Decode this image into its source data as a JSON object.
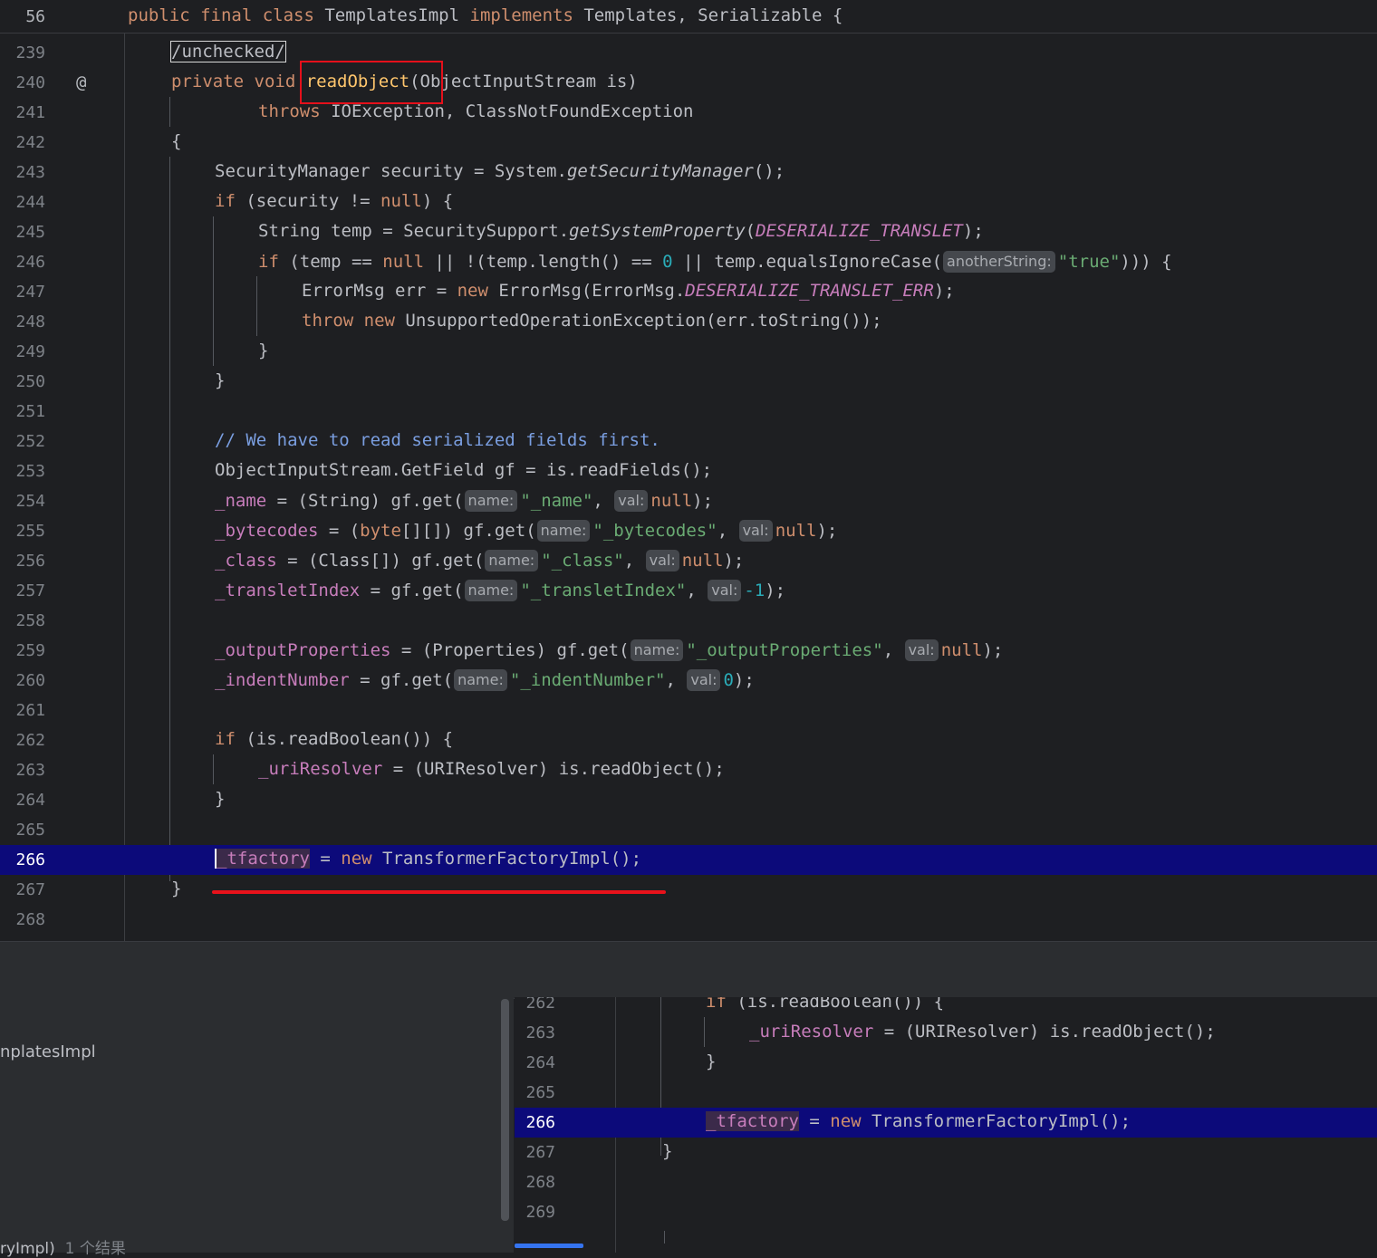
{
  "sticky": {
    "line_no": "56",
    "kw1": "public final class",
    "name": " TemplatesImpl ",
    "kw2": "implements",
    "rest": " Templates, Serializable {"
  },
  "hints": {
    "anotherString": "anotherString:",
    "name": "name:",
    "val": "val:"
  },
  "lines": [
    {
      "n": "239"
    },
    {
      "n": "240"
    },
    {
      "n": "241"
    },
    {
      "n": "242"
    },
    {
      "n": "243"
    },
    {
      "n": "244"
    },
    {
      "n": "245"
    },
    {
      "n": "246"
    },
    {
      "n": "247"
    },
    {
      "n": "248"
    },
    {
      "n": "249"
    },
    {
      "n": "250"
    },
    {
      "n": "251"
    },
    {
      "n": "252"
    },
    {
      "n": "253"
    },
    {
      "n": "254"
    },
    {
      "n": "255"
    },
    {
      "n": "256"
    },
    {
      "n": "257"
    },
    {
      "n": "258"
    },
    {
      "n": "259"
    },
    {
      "n": "260"
    },
    {
      "n": "261"
    },
    {
      "n": "262"
    },
    {
      "n": "263"
    },
    {
      "n": "264"
    },
    {
      "n": "265"
    },
    {
      "n": "266"
    },
    {
      "n": "267"
    },
    {
      "n": "268"
    }
  ],
  "code": {
    "l239": "/unchecked/",
    "l240a": "private void ",
    "l240b": "readObject",
    "l240c": "(ObjectInputStream is)",
    "l241a": "throws",
    "l241b": " IOException, ClassNotFoundException",
    "l242": "{",
    "l243a": "SecurityManager security = System.",
    "l243b": "getSecurityManager",
    "l243c": "();",
    "l244a": "if",
    "l244b": " (security != ",
    "l244c": "null",
    "l244d": ") {",
    "l245a": "String temp = SecuritySupport.",
    "l245b": "getSystemProperty",
    "l245c": "(",
    "l245d": "DESERIALIZE_TRANSLET",
    "l245e": ");",
    "l246a": "if",
    "l246b": " (temp == ",
    "l246c": "null",
    "l246d": " || !(temp.length() == ",
    "l246e": "0",
    "l246f": " || temp.equalsIgnoreCase(",
    "l246g": "\"true\"",
    "l246h": "))) {",
    "l247a": "ErrorMsg err = ",
    "l247b": "new",
    "l247c": " ErrorMsg(ErrorMsg.",
    "l247d": "DESERIALIZE_TRANSLET_ERR",
    "l247e": ");",
    "l248a": "throw new",
    "l248b": " UnsupportedOperationException(err.toString());",
    "l249": "}",
    "l250": "}",
    "l252": "// We have to read serialized fields first.",
    "l253": "ObjectInputStream.GetField gf = is.readFields();",
    "l254a": "_name",
    "l254b": " = (String) gf.get(",
    "l254c": "\"_name\"",
    "l254d": ", ",
    "l254e": "null",
    "l254f": ");",
    "l255a": "_bytecodes",
    "l255b": " = (",
    "l255c": "byte",
    "l255d": "[][]) gf.get(",
    "l255e": "\"_bytecodes\"",
    "l255f": ", ",
    "l255g": "null",
    "l255h": ");",
    "l256a": "_class",
    "l256b": " = (Class[]) gf.get(",
    "l256c": "\"_class\"",
    "l256d": ", ",
    "l256e": "null",
    "l256f": ");",
    "l257a": "_transletIndex",
    "l257b": " = gf.get(",
    "l257c": "\"_transletIndex\"",
    "l257d": ", ",
    "l257e": "-1",
    "l257f": ");",
    "l259a": "_outputProperties",
    "l259b": " = (Properties) gf.get(",
    "l259c": "\"_outputProperties\"",
    "l259d": ", ",
    "l259e": "null",
    "l259f": ");",
    "l260a": "_indentNumber",
    "l260b": " = gf.get(",
    "l260c": "\"_indentNumber\"",
    "l260d": ", ",
    "l260e": "0",
    "l260f": ");",
    "l262a": "if",
    "l262b": " (is.readBoolean()) {",
    "l263a": "_uriResolver",
    "l263b": " = (URIResolver) is.readObject();",
    "l264": "}",
    "l266a": "_tfactory",
    "l266b": " = ",
    "l266c": "new",
    "l266d": " TransformerFactoryImpl();",
    "l267": "}"
  },
  "bottom": {
    "left_item": "nplatesImpl",
    "footer_a": "ryImpl)",
    "footer_b": "1 个结果",
    "preview_lines": [
      "262",
      "263",
      "264",
      "265",
      "266",
      "267",
      "268",
      "269"
    ]
  }
}
